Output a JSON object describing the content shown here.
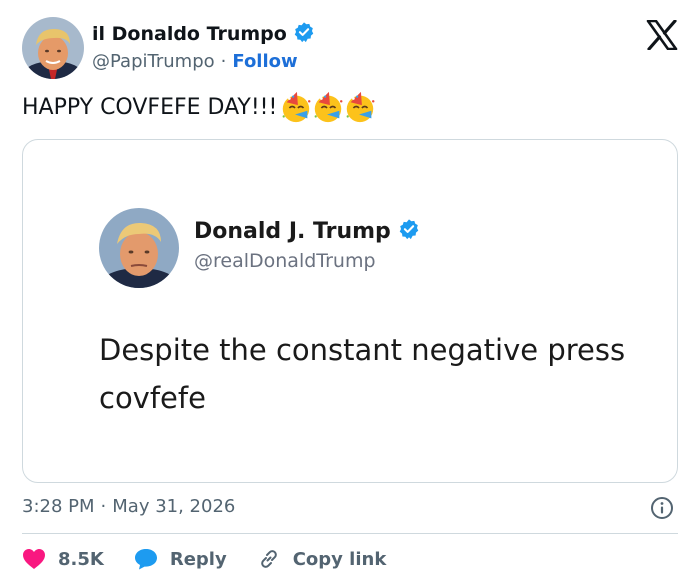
{
  "author": {
    "display_name": "il Donaldo Trumpo",
    "handle": "@PapiTrumpo",
    "separator": "·",
    "follow_label": "Follow",
    "verified_icon": "verified-badge-icon"
  },
  "tweet": {
    "text": "HAPPY COVFEFE DAY!!!",
    "emoji_icons": [
      "party-face-icon",
      "party-face-icon",
      "party-face-icon"
    ]
  },
  "quoted_image": {
    "display_name": "Donald J. Trump",
    "handle": "@realDonaldTrump",
    "body_line1": "Despite the constant negative press",
    "body_line2": "covfefe"
  },
  "meta": {
    "time": "3:28 PM",
    "separator": "·",
    "date": "May 31, 2026"
  },
  "actions": {
    "like_count": "8.5K",
    "reply_label": "Reply",
    "copy_link_label": "Copy link"
  },
  "colors": {
    "accent": "#1d9bf0",
    "follow_link": "#1d6fd8",
    "like_heart": "#f91880",
    "secondary_text": "#536471",
    "border": "#cfd9de"
  }
}
